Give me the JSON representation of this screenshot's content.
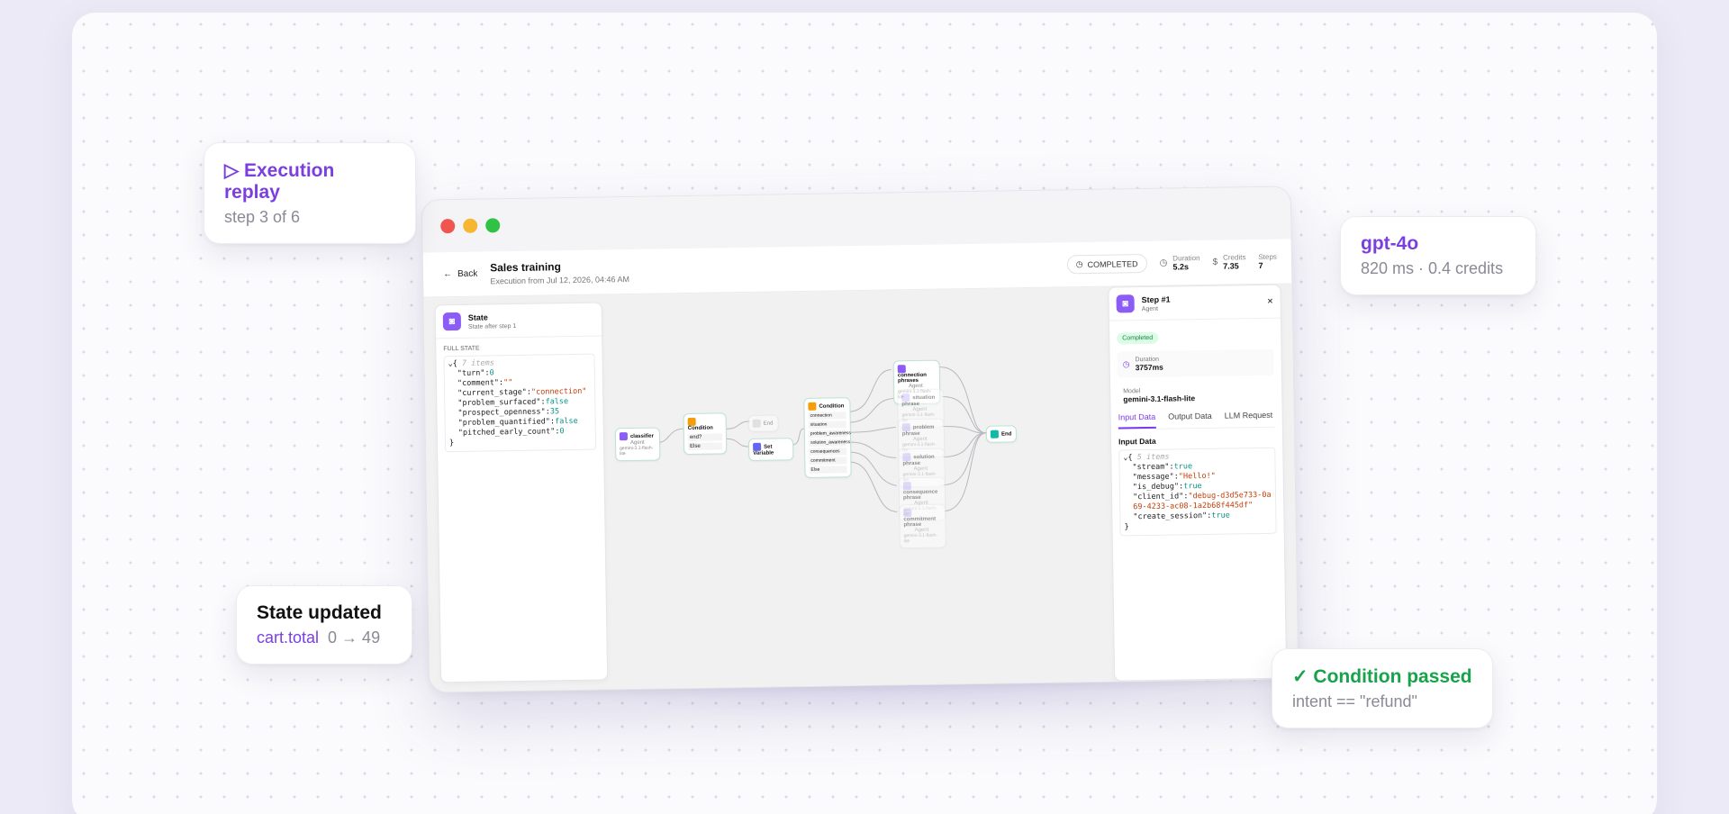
{
  "cards": {
    "replay": {
      "title": "▷ Execution replay",
      "sub": "step 3 of 6"
    },
    "model": {
      "title": "gpt-4o",
      "sub": "820 ms · 0.4 credits"
    },
    "state": {
      "title": "State updated",
      "key": "cart.total",
      "change": "0 → 49"
    },
    "condition": {
      "title": "✓ Condition passed",
      "sub": "intent == \"refund\""
    }
  },
  "window": {
    "back_label": "Back",
    "title": "Sales training",
    "subtitle": "Execution from Jul 12, 2026, 04:46 AM",
    "status": "COMPLETED",
    "stats": [
      {
        "label": "Duration",
        "value": "5.2s",
        "icon": "clock-icon"
      },
      {
        "label": "Credits",
        "value": "7.35",
        "icon": "dollar-icon"
      },
      {
        "label": "Steps",
        "value": "7",
        "icon": ""
      }
    ]
  },
  "state_panel": {
    "title": "State",
    "subtitle": "State after step 1",
    "section": "FULL STATE",
    "count_comment": "7 items",
    "entries": [
      {
        "key": "\"turn\"",
        "value": "0",
        "type": "num"
      },
      {
        "key": "\"comment\"",
        "value": "\"\"",
        "type": "str"
      },
      {
        "key": "\"current_stage\"",
        "value": "\"connection\"",
        "type": "str"
      },
      {
        "key": "\"problem_surfaced\"",
        "value": "false",
        "type": "bool"
      },
      {
        "key": "\"prospect_openness\"",
        "value": "35",
        "type": "num"
      },
      {
        "key": "\"problem_quantified\"",
        "value": "false",
        "type": "bool"
      },
      {
        "key": "\"pitched_early_count\"",
        "value": "0",
        "type": "num"
      }
    ]
  },
  "step_panel": {
    "title": "Step #1",
    "subtitle": "Agent",
    "badge": "Completed",
    "duration_label": "Duration",
    "duration_value": "3757ms",
    "model_label": "Model",
    "model_value": "gemini-3.1-flash-lite",
    "tabs": [
      "Input Data",
      "Output Data",
      "LLM Request"
    ],
    "section": "Input Data",
    "count_comment": "5 items",
    "entries": [
      {
        "key": "\"stream\"",
        "value": "true",
        "type": "bool"
      },
      {
        "key": "\"message\"",
        "value": "\"Hello!\"",
        "type": "str"
      },
      {
        "key": "\"is_debug\"",
        "value": "true",
        "type": "bool"
      },
      {
        "key": "\"client_id\"",
        "value": "\"debug-d3d5e733-0a69-4233-ac08-1a2b68f445df\"",
        "type": "str"
      },
      {
        "key": "\"create_session\"",
        "value": "true",
        "type": "bool"
      }
    ]
  },
  "graph": {
    "classifier": {
      "title": "classifier",
      "sub": "Agent",
      "model": "gemini-3.1-flash-lite"
    },
    "condition1": {
      "title": "Condition",
      "rows": [
        "end?",
        "Else"
      ]
    },
    "end_small": "End",
    "set_variable": "Set Variable",
    "condition2": {
      "title": "Condition",
      "rows": [
        "connection",
        "situation",
        "problem_awareness",
        "solution_awareness",
        "consequences",
        "commitment",
        "Else"
      ]
    },
    "agents": [
      {
        "title": "connection phrases",
        "sub": "Agent",
        "model": "gemini-3.1-flash-lite"
      },
      {
        "title": "situation phrase",
        "sub": "Agent",
        "model": "gemini-3.1-flash-lite"
      },
      {
        "title": "problem phrase",
        "sub": "Agent",
        "model": "gemini-3.1-flash-lite"
      },
      {
        "title": "solution phrase",
        "sub": "Agent",
        "model": "gemini-3.1-flash-lite"
      },
      {
        "title": "consequence phrase",
        "sub": "Agent",
        "model": "gemini-3.1-flash-lite"
      },
      {
        "title": "commitment phrase",
        "sub": "Agent",
        "model": "gemini-3.1-flash-lite"
      }
    ],
    "end": "End"
  }
}
